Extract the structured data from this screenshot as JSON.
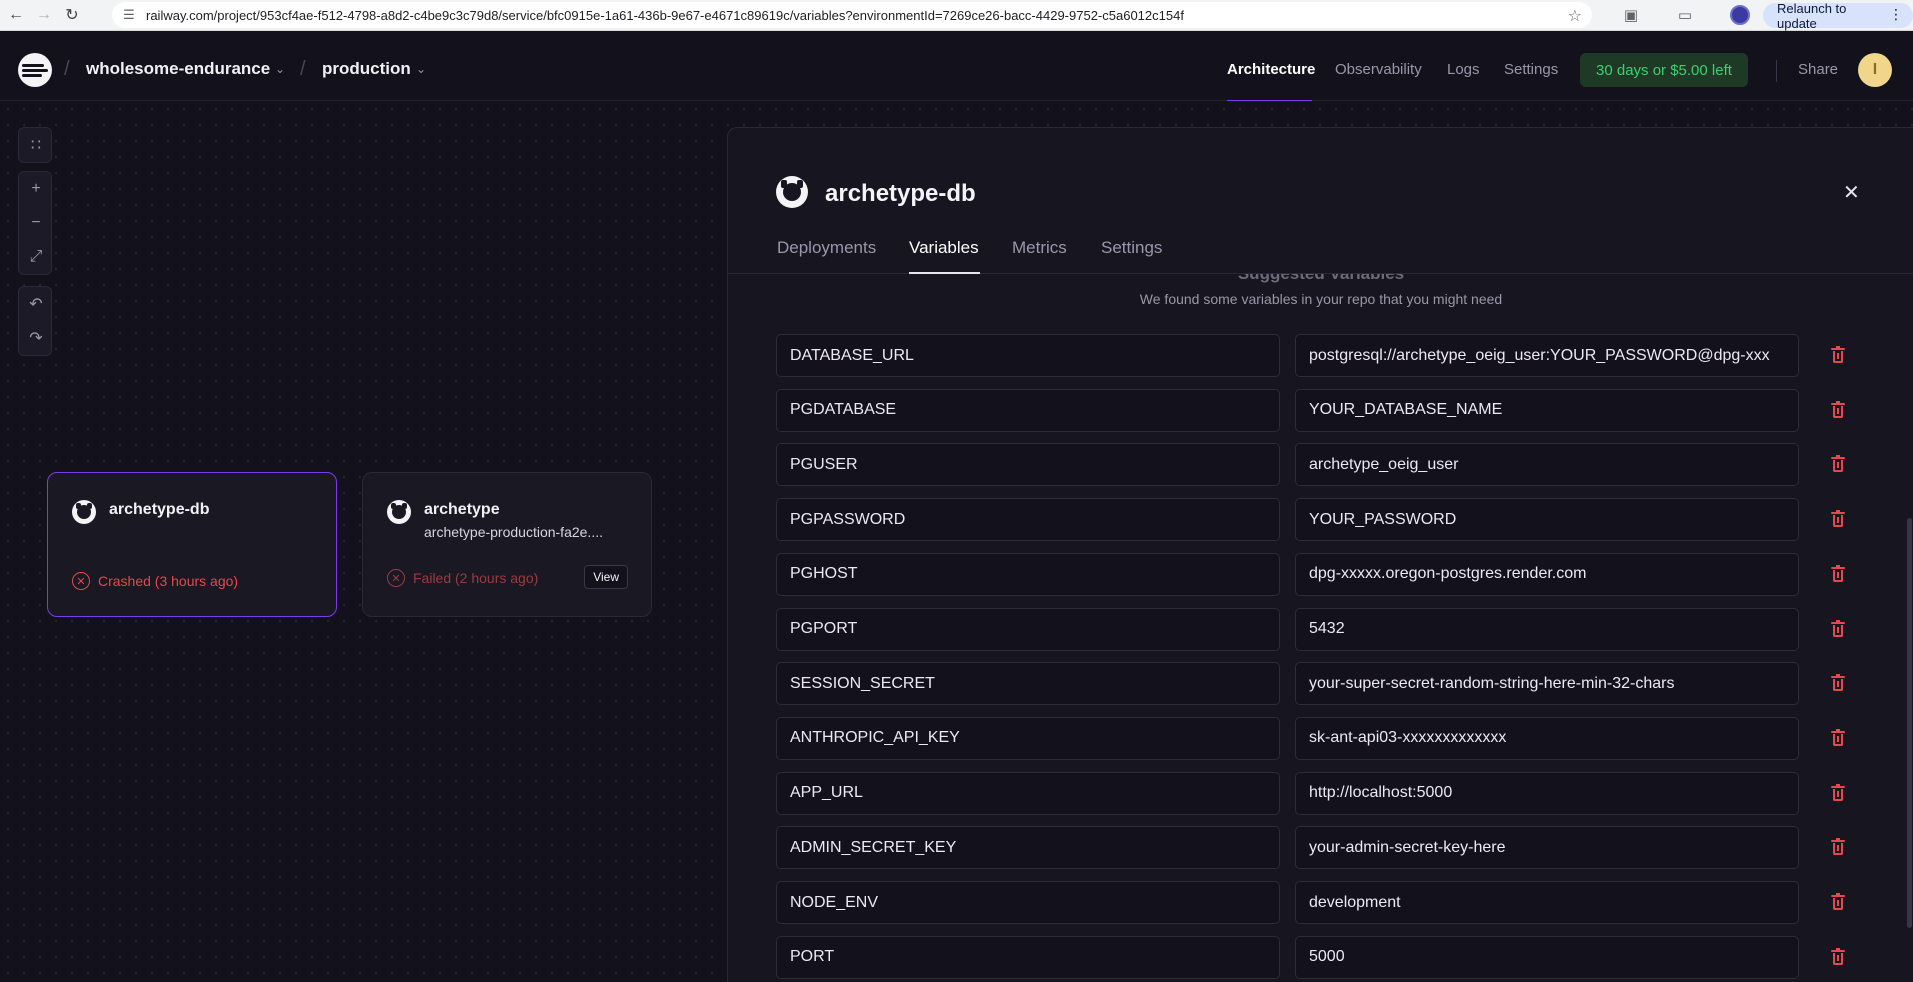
{
  "browser": {
    "url": "railway.com/project/953cf4ae-f512-4798-a8d2-c4be9c3c79d8/service/bfc0915e-1a61-436b-9e67-e4671c89619c/variables?environmentId=7269ce26-bacc-4429-9752-c5a6012c154f",
    "relaunch_label": "Relaunch to update"
  },
  "header": {
    "project": "wholesome-endurance",
    "environment": "production",
    "nav": [
      "Architecture",
      "Observability",
      "Logs",
      "Settings"
    ],
    "trial": "30 days or $5.00 left",
    "share": "Share",
    "avatar_initial": "I"
  },
  "canvas": {
    "services": [
      {
        "name": "archetype-db",
        "subtitle": "",
        "status": "Crashed (3 hours ago)",
        "selected": true
      },
      {
        "name": "archetype",
        "subtitle": "archetype-production-fa2e....",
        "status": "Failed (2 hours ago)",
        "action": "View",
        "selected": false
      }
    ]
  },
  "panel": {
    "title": "archetype-db",
    "tabs": [
      "Deployments",
      "Variables",
      "Metrics",
      "Settings"
    ],
    "active_tab": "Variables",
    "section_title": "Suggested Variables",
    "section_subtitle": "We found some variables in your repo that you might need",
    "variables": [
      {
        "key": "DATABASE_URL",
        "value": "postgresql://archetype_oeig_user:YOUR_PASSWORD@dpg-xxx"
      },
      {
        "key": "PGDATABASE",
        "value": "YOUR_DATABASE_NAME"
      },
      {
        "key": "PGUSER",
        "value": "archetype_oeig_user"
      },
      {
        "key": "PGPASSWORD",
        "value": "YOUR_PASSWORD"
      },
      {
        "key": "PGHOST",
        "value": "dpg-xxxxx.oregon-postgres.render.com"
      },
      {
        "key": "PGPORT",
        "value": "5432"
      },
      {
        "key": "SESSION_SECRET",
        "value": "your-super-secret-random-string-here-min-32-chars"
      },
      {
        "key": "ANTHROPIC_API_KEY",
        "value": "sk-ant-api03-xxxxxxxxxxxxx"
      },
      {
        "key": "APP_URL",
        "value": "http://localhost:5000"
      },
      {
        "key": "ADMIN_SECRET_KEY",
        "value": "your-admin-secret-key-here"
      },
      {
        "key": "NODE_ENV",
        "value": "development"
      },
      {
        "key": "PORT",
        "value": "5000"
      }
    ]
  },
  "colors": {
    "background": "#13111c",
    "accent": "#7c3aed",
    "error": "#e5484d",
    "trial_text": "#3ecf6e"
  }
}
